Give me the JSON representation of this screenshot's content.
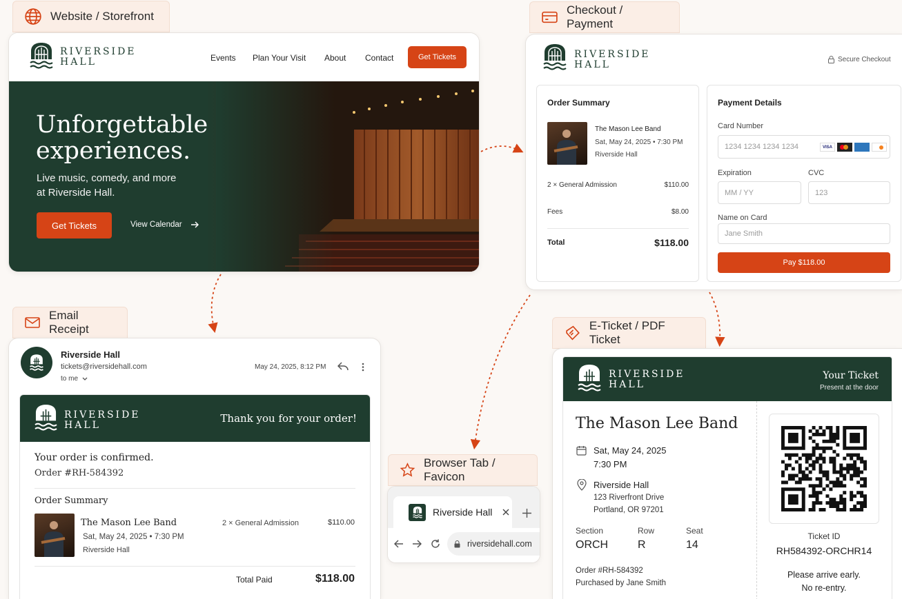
{
  "sections": {
    "website": "Website / Storefront",
    "checkout": "Checkout / Payment",
    "email": "Email Receipt",
    "browser": "Browser Tab / Favicon",
    "ticket": "E-Ticket / PDF Ticket"
  },
  "brand": {
    "line1": "RIVERSIDE",
    "line2": "HALL",
    "name": "Riverside Hall"
  },
  "website": {
    "nav": [
      "Events",
      "Plan Your Visit",
      "About",
      "Contact"
    ],
    "nav_cta": "Get Tickets",
    "hero_title_1": "Unforgettable",
    "hero_title_2": "experiences.",
    "hero_sub_1": "Live music, comedy, and more",
    "hero_sub_2": "at Riverside Hall.",
    "cta": "Get Tickets",
    "secondary": "View Calendar"
  },
  "checkout": {
    "secure": "Secure Checkout",
    "summary_title": "Order Summary",
    "event": "The Mason Lee Band",
    "date": "Sat, May 24, 2025 • 7:30 PM",
    "venue": "Riverside Hall",
    "line_item": "2 × General Admission",
    "line_price": "$110.00",
    "fees_label": "Fees",
    "fees": "$8.00",
    "total_label": "Total",
    "total": "$118.00",
    "payment_title": "Payment Details",
    "card_label": "Card Number",
    "card_placeholder": "1234 1234 1234 1234",
    "exp_label": "Expiration",
    "exp_placeholder": "MM / YY",
    "cvc_label": "CVC",
    "cvc_placeholder": "123",
    "name_label": "Name on Card",
    "name_placeholder": "Jane Smith",
    "pay_button": "Pay $118.00",
    "card_brands": [
      "VISA",
      "MC",
      "AMEX",
      "DISCOVER"
    ]
  },
  "email": {
    "sender": "Riverside Hall",
    "address": "tickets@riversidehall.com",
    "to": "to me",
    "timestamp": "May 24, 2025, 8:12 PM",
    "banner": "Thank you for your order!",
    "confirmed": "Your order is confirmed.",
    "order_no": "Order #RH-584392",
    "summary_title": "Order Summary",
    "event": "The Mason Lee Band",
    "date": "Sat, May 24, 2025 • 7:30 PM",
    "venue": "Riverside Hall",
    "line_item": "2 × General Admission",
    "line_price": "$110.00",
    "total_label": "Total Paid",
    "total": "$118.00"
  },
  "browser": {
    "tab_title": "Riverside Hall",
    "url": "riversidehall.com"
  },
  "ticket": {
    "header_title": "Your Ticket",
    "header_sub": "Present at the door",
    "event": "The Mason Lee Band",
    "date": "Sat, May 24, 2025",
    "time": "7:30 PM",
    "venue": "Riverside Hall",
    "street": "123 Riverfront Drive",
    "city": "Portland, OR 97201",
    "section_label": "Section",
    "section": "ORCH",
    "row_label": "Row",
    "row": "R",
    "seat_label": "Seat",
    "seat": "14",
    "order_no": "Order #RH-584392",
    "purchaser": "Purchased by Jane Smith",
    "id_label": "Ticket ID",
    "id": "RH584392-ORCHR14",
    "note_1": "Please arrive early.",
    "note_2": "No re-entry."
  },
  "colors": {
    "accent": "#d64416",
    "brand_green": "#1f3d2f",
    "label_bg": "#fbeee6"
  }
}
